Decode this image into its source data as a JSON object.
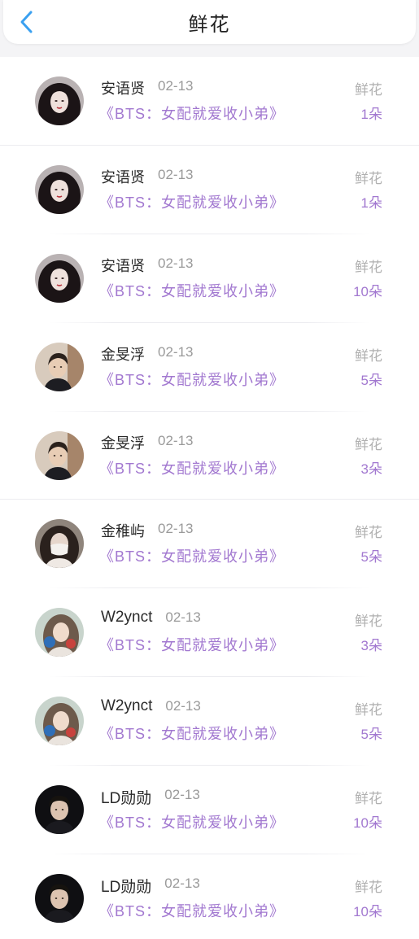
{
  "header": {
    "title": "鲜花",
    "back_icon": "chevron-left-icon",
    "accent": "#3aa0f0"
  },
  "colors": {
    "book_title": "#a278d0",
    "muted": "#9a9a9a"
  },
  "rows": [
    {
      "name": "安语贤",
      "date": "02-13",
      "book": "《BTS：女配就爱收小弟》",
      "label": "鲜花",
      "count": "1朵",
      "avatar": "avatar-girl-dark-hair"
    },
    {
      "name": "安语贤",
      "date": "02-13",
      "book": "《BTS：女配就爱收小弟》",
      "label": "鲜花",
      "count": "1朵",
      "avatar": "avatar-girl-dark-hair"
    },
    {
      "name": "安语贤",
      "date": "02-13",
      "book": "《BTS：女配就爱收小弟》",
      "label": "鲜花",
      "count": "10朵",
      "avatar": "avatar-girl-dark-hair"
    },
    {
      "name": "金旻浮",
      "date": "02-13",
      "book": "《BTS：女配就爱收小弟》",
      "label": "鲜花",
      "count": "5朵",
      "avatar": "avatar-boy"
    },
    {
      "name": "金旻浮",
      "date": "02-13",
      "book": "《BTS：女配就爱收小弟》",
      "label": "鲜花",
      "count": "3朵",
      "avatar": "avatar-boy"
    },
    {
      "name": "金稚屿",
      "date": "02-13",
      "book": "《BTS：女配就爱收小弟》",
      "label": "鲜花",
      "count": "5朵",
      "avatar": "avatar-masked"
    },
    {
      "name": "W2ynct",
      "date": "02-13",
      "book": "《BTS：女配就爱收小弟》",
      "label": "鲜花",
      "count": "3朵",
      "avatar": "avatar-girl-light"
    },
    {
      "name": "W2ynct",
      "date": "02-13",
      "book": "《BTS：女配就爱收小弟》",
      "label": "鲜花",
      "count": "5朵",
      "avatar": "avatar-girl-light"
    },
    {
      "name": "LD勋勋",
      "date": "02-13",
      "book": "《BTS：女配就爱收小弟》",
      "label": "鲜花",
      "count": "10朵",
      "avatar": "avatar-boy-dark"
    },
    {
      "name": "LD勋勋",
      "date": "02-13",
      "book": "《BTS：女配就爱收小弟》",
      "label": "鲜花",
      "count": "10朵",
      "avatar": "avatar-boy-dark"
    }
  ]
}
